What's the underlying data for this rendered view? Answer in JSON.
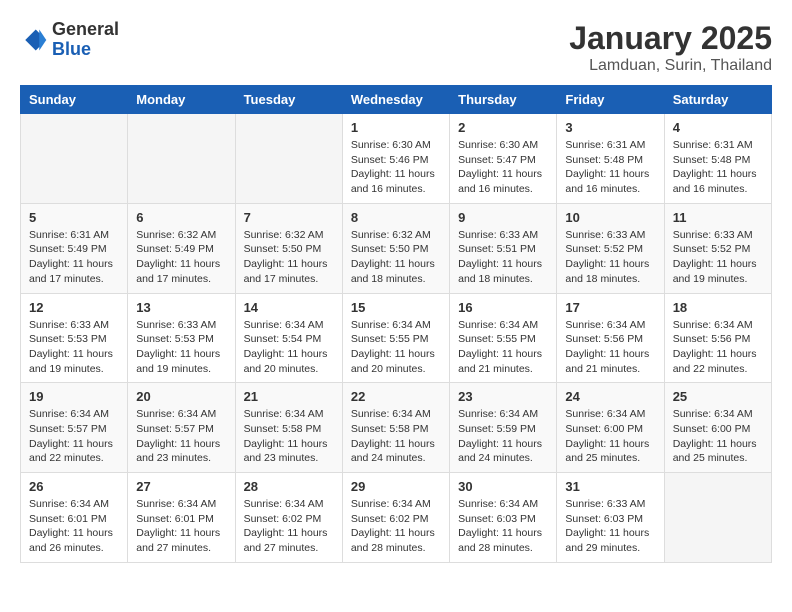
{
  "logo": {
    "general": "General",
    "blue": "Blue"
  },
  "title": "January 2025",
  "subtitle": "Lamduan, Surin, Thailand",
  "weekdays": [
    "Sunday",
    "Monday",
    "Tuesday",
    "Wednesday",
    "Thursday",
    "Friday",
    "Saturday"
  ],
  "weeks": [
    [
      {
        "day": "",
        "info": ""
      },
      {
        "day": "",
        "info": ""
      },
      {
        "day": "",
        "info": ""
      },
      {
        "day": "1",
        "info": "Sunrise: 6:30 AM\nSunset: 5:46 PM\nDaylight: 11 hours and 16 minutes."
      },
      {
        "day": "2",
        "info": "Sunrise: 6:30 AM\nSunset: 5:47 PM\nDaylight: 11 hours and 16 minutes."
      },
      {
        "day": "3",
        "info": "Sunrise: 6:31 AM\nSunset: 5:48 PM\nDaylight: 11 hours and 16 minutes."
      },
      {
        "day": "4",
        "info": "Sunrise: 6:31 AM\nSunset: 5:48 PM\nDaylight: 11 hours and 16 minutes."
      }
    ],
    [
      {
        "day": "5",
        "info": "Sunrise: 6:31 AM\nSunset: 5:49 PM\nDaylight: 11 hours and 17 minutes."
      },
      {
        "day": "6",
        "info": "Sunrise: 6:32 AM\nSunset: 5:49 PM\nDaylight: 11 hours and 17 minutes."
      },
      {
        "day": "7",
        "info": "Sunrise: 6:32 AM\nSunset: 5:50 PM\nDaylight: 11 hours and 17 minutes."
      },
      {
        "day": "8",
        "info": "Sunrise: 6:32 AM\nSunset: 5:50 PM\nDaylight: 11 hours and 18 minutes."
      },
      {
        "day": "9",
        "info": "Sunrise: 6:33 AM\nSunset: 5:51 PM\nDaylight: 11 hours and 18 minutes."
      },
      {
        "day": "10",
        "info": "Sunrise: 6:33 AM\nSunset: 5:52 PM\nDaylight: 11 hours and 18 minutes."
      },
      {
        "day": "11",
        "info": "Sunrise: 6:33 AM\nSunset: 5:52 PM\nDaylight: 11 hours and 19 minutes."
      }
    ],
    [
      {
        "day": "12",
        "info": "Sunrise: 6:33 AM\nSunset: 5:53 PM\nDaylight: 11 hours and 19 minutes."
      },
      {
        "day": "13",
        "info": "Sunrise: 6:33 AM\nSunset: 5:53 PM\nDaylight: 11 hours and 19 minutes."
      },
      {
        "day": "14",
        "info": "Sunrise: 6:34 AM\nSunset: 5:54 PM\nDaylight: 11 hours and 20 minutes."
      },
      {
        "day": "15",
        "info": "Sunrise: 6:34 AM\nSunset: 5:55 PM\nDaylight: 11 hours and 20 minutes."
      },
      {
        "day": "16",
        "info": "Sunrise: 6:34 AM\nSunset: 5:55 PM\nDaylight: 11 hours and 21 minutes."
      },
      {
        "day": "17",
        "info": "Sunrise: 6:34 AM\nSunset: 5:56 PM\nDaylight: 11 hours and 21 minutes."
      },
      {
        "day": "18",
        "info": "Sunrise: 6:34 AM\nSunset: 5:56 PM\nDaylight: 11 hours and 22 minutes."
      }
    ],
    [
      {
        "day": "19",
        "info": "Sunrise: 6:34 AM\nSunset: 5:57 PM\nDaylight: 11 hours and 22 minutes."
      },
      {
        "day": "20",
        "info": "Sunrise: 6:34 AM\nSunset: 5:57 PM\nDaylight: 11 hours and 23 minutes."
      },
      {
        "day": "21",
        "info": "Sunrise: 6:34 AM\nSunset: 5:58 PM\nDaylight: 11 hours and 23 minutes."
      },
      {
        "day": "22",
        "info": "Sunrise: 6:34 AM\nSunset: 5:58 PM\nDaylight: 11 hours and 24 minutes."
      },
      {
        "day": "23",
        "info": "Sunrise: 6:34 AM\nSunset: 5:59 PM\nDaylight: 11 hours and 24 minutes."
      },
      {
        "day": "24",
        "info": "Sunrise: 6:34 AM\nSunset: 6:00 PM\nDaylight: 11 hours and 25 minutes."
      },
      {
        "day": "25",
        "info": "Sunrise: 6:34 AM\nSunset: 6:00 PM\nDaylight: 11 hours and 25 minutes."
      }
    ],
    [
      {
        "day": "26",
        "info": "Sunrise: 6:34 AM\nSunset: 6:01 PM\nDaylight: 11 hours and 26 minutes."
      },
      {
        "day": "27",
        "info": "Sunrise: 6:34 AM\nSunset: 6:01 PM\nDaylight: 11 hours and 27 minutes."
      },
      {
        "day": "28",
        "info": "Sunrise: 6:34 AM\nSunset: 6:02 PM\nDaylight: 11 hours and 27 minutes."
      },
      {
        "day": "29",
        "info": "Sunrise: 6:34 AM\nSunset: 6:02 PM\nDaylight: 11 hours and 28 minutes."
      },
      {
        "day": "30",
        "info": "Sunrise: 6:34 AM\nSunset: 6:03 PM\nDaylight: 11 hours and 28 minutes."
      },
      {
        "day": "31",
        "info": "Sunrise: 6:33 AM\nSunset: 6:03 PM\nDaylight: 11 hours and 29 minutes."
      },
      {
        "day": "",
        "info": ""
      }
    ]
  ]
}
